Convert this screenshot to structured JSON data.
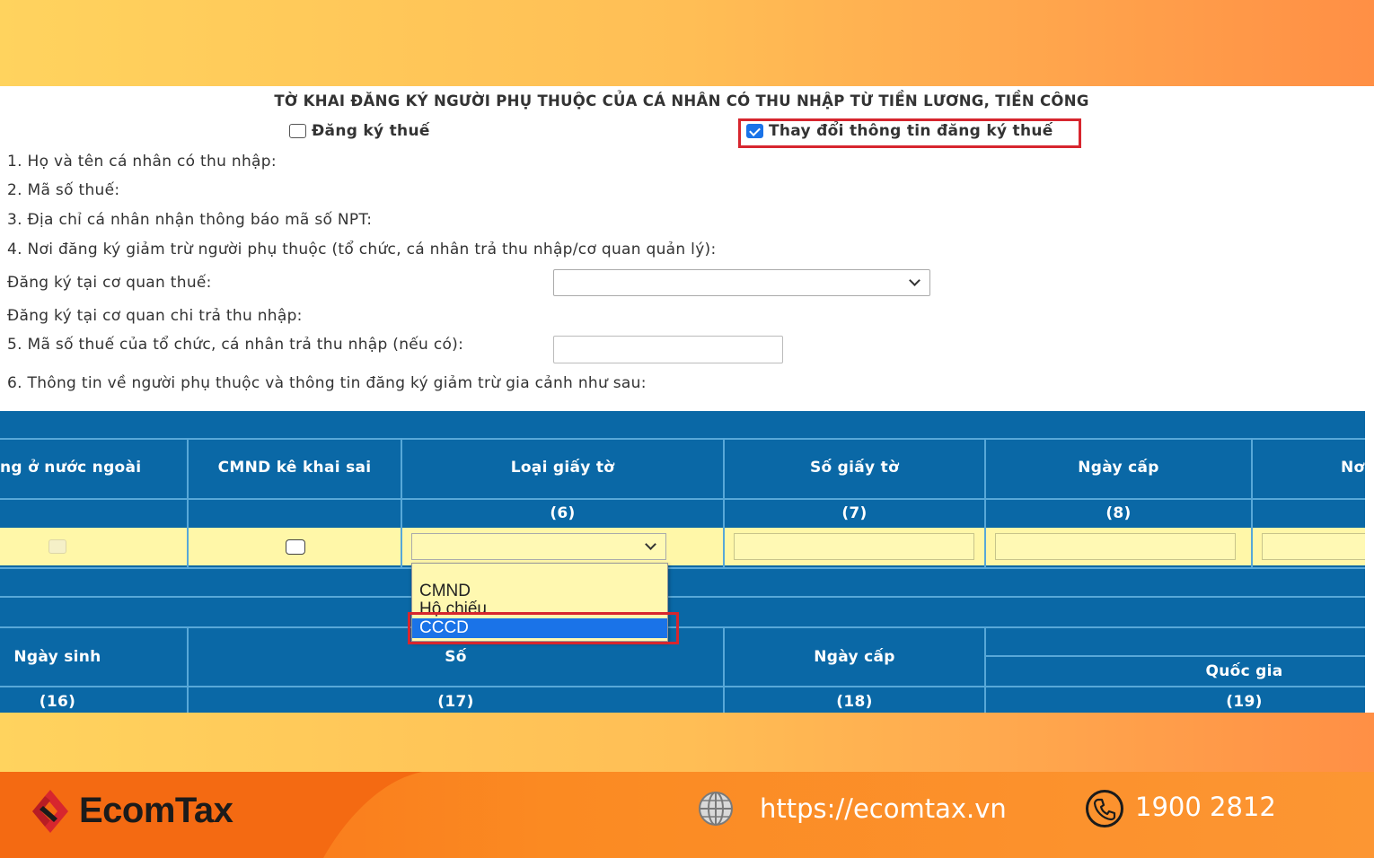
{
  "form": {
    "title": "TỜ KHAI ĐĂNG KÝ NGƯỜI PHỤ THUỘC CỦA CÁ NHÂN CÓ THU NHẬP TỪ TIỀN LƯƠNG, TIỀN CÔNG",
    "checkbox_register": {
      "label": "Đăng ký thuế",
      "checked": false
    },
    "checkbox_change": {
      "label": "Thay đổi thông tin đăng ký thuế",
      "checked": true
    },
    "line1": "1. Họ và tên cá nhân có thu nhập:",
    "line2": "2. Mã số thuế:",
    "line3": "3. Địa chỉ cá nhân nhận thông báo mã số NPT:",
    "line4": "4. Nơi đăng ký giảm trừ người phụ thuộc (tổ chức, cá nhân trả thu nhập/cơ quan quản lý):",
    "tax_office_label": "Đăng ký tại cơ quan thuế:",
    "payer_label": "Đăng ký tại cơ quan chi trả thu nhập:",
    "line5": "5. Mã số thuế của tổ chức, cá nhân trả thu nhập (nếu có):",
    "line6": "6. Thông tin về người phụ thuộc và thông tin đăng ký giảm trừ gia cảnh như sau:"
  },
  "table": {
    "headers": {
      "abroad": "ng ở nước ngoài",
      "id_wrong": "CMND kê khai sai",
      "doc_type": "Loại giấy tờ",
      "doc_no": "Số giấy tờ",
      "issue_date": "Ngày cấp",
      "place_partial": "Nơ"
    },
    "col_numbers": {
      "c6": "(6)",
      "c7": "(7)",
      "c8": "(8)"
    },
    "headers2": {
      "dob": "Ngày sinh",
      "number": "Số",
      "issue_date": "Ngày cấp",
      "country": "Quốc gia"
    },
    "col_numbers2": {
      "c16": "(16)",
      "c17": "(17)",
      "c18": "(18)",
      "c19": "(19)"
    }
  },
  "dropdown": {
    "options": [
      "CMND",
      "Hộ chiếu",
      "CCCD"
    ],
    "selected": "CCCD"
  },
  "footer": {
    "brand": "EcomTax",
    "website": "https://ecomtax.vn",
    "phone": "1900 2812"
  },
  "colors": {
    "table_blue": "#0a68a6",
    "highlight_red": "#d7262e",
    "selection_blue": "#1a73e8",
    "footer_orange": "#f86e16"
  }
}
